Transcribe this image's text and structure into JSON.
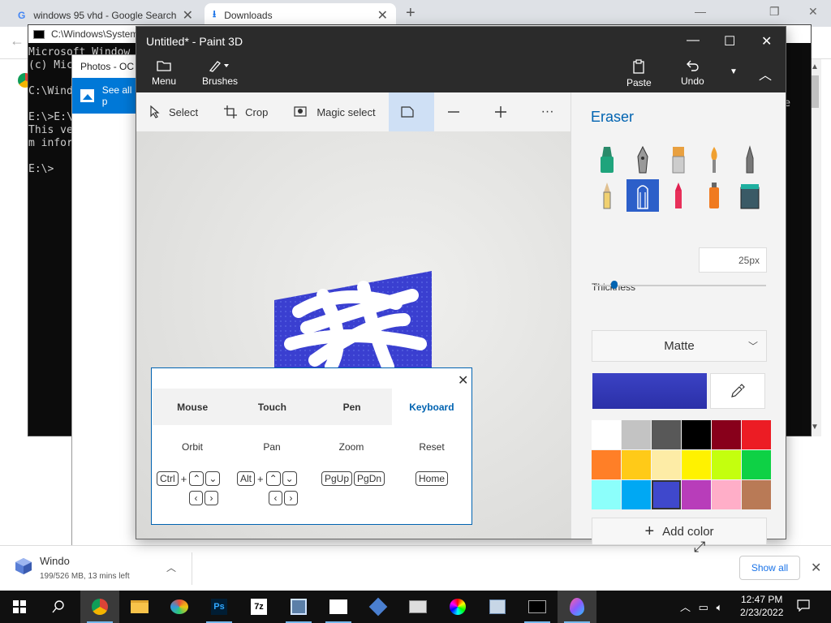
{
  "chrome": {
    "tabs": [
      {
        "label": "windows 95 vhd - Google Search"
      },
      {
        "label": "Downloads"
      }
    ],
    "new_tab": "+",
    "win_controls": {
      "min": "—",
      "max": "❐",
      "close": "✕"
    }
  },
  "cmd": {
    "title": "C:\\Windows\\System",
    "lines": "Microsoft Window\n(c) Mic\n\nC:\\Wind\n\nE:\\>E:\\\nThis ve\nm infor\n\nE:\\>",
    "right_text": "syste\n\n"
  },
  "photos": {
    "title": "Photos - OC",
    "see_all": "See all p"
  },
  "download_bar": {
    "file_name": "Windo",
    "status": "199/526 MB, 13 mins left",
    "show_all": "Show all"
  },
  "paint3d": {
    "title": "Untitled* - Paint 3D",
    "menu_label": "Menu",
    "brushes_label": "Brushes",
    "paste_label": "Paste",
    "undo_label": "Undo",
    "tools": [
      {
        "label": "Select"
      },
      {
        "label": "Crop"
      },
      {
        "label": "Magic select"
      }
    ],
    "more": "···",
    "panel": {
      "title": "Eraser",
      "thickness_label": "Thickness",
      "thickness_value": "25px",
      "thickness_level": 0.12,
      "finish": "Matte",
      "add_color": "Add color",
      "current_color": "#3b42c4",
      "palette": [
        "#ffffff",
        "#c3c3c3",
        "#585858",
        "#000000",
        "#88001b",
        "#ec1c24",
        "#ff7f27",
        "#ffca18",
        "#fdeca6",
        "#fff200",
        "#c4ff0e",
        "#0ed145",
        "#8cfffb",
        "#00a8f3",
        "#3f48cc",
        "#b83dba",
        "#ffaec8",
        "#b97a56"
      ],
      "selected_swatch": 14
    }
  },
  "controls_popup": {
    "tabs": [
      {
        "label": "Mouse"
      },
      {
        "label": "Touch"
      },
      {
        "label": "Pen"
      },
      {
        "label": "Keyboard"
      }
    ],
    "actions": [
      {
        "label": "Orbit"
      },
      {
        "label": "Pan"
      },
      {
        "label": "Zoom"
      },
      {
        "label": "Reset"
      }
    ],
    "keys": {
      "ctrl": "Ctrl",
      "alt": "Alt",
      "pgup": "PgUp",
      "pgdn": "PgDn",
      "home": "Home",
      "plus": "+"
    }
  },
  "taskbar": {
    "time": "12:47 PM",
    "date": "2/23/2022"
  }
}
